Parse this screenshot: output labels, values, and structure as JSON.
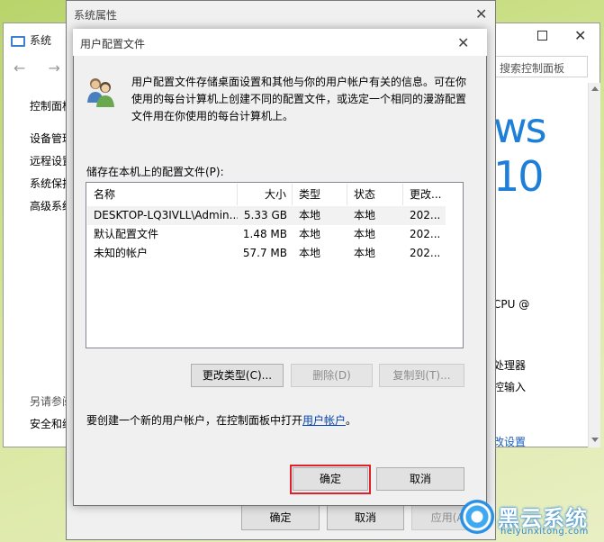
{
  "system_window": {
    "title": "系统",
    "nav": "← →",
    "left_links": [
      "控制面板主页",
      "设备管理器",
      "远程设置",
      "系统保护",
      "高级系统设置"
    ],
    "see_also_label": "另请参阅",
    "see_also_item": "安全和维护",
    "search_placeholder": "搜索控制面板",
    "windows_brand": "ws 10",
    "cpu_text": "CPU @",
    "processor_text": "处理器",
    "touch_text": "控输入",
    "change_settings_link": "改设置"
  },
  "system_properties": {
    "title": "系统属性",
    "close": "✕",
    "ok": "确定",
    "cancel": "取消",
    "apply": "应用(A)"
  },
  "profile_dialog": {
    "title": "用户配置文件",
    "close": "✕",
    "description": "用户配置文件存储桌面设置和其他与你的用户帐户有关的信息。可在你使用的每台计算机上创建不同的配置文件，或选定一个相同的漫游配置文件用在你使用的每台计算机上。",
    "stored_label": "储存在本机上的配置文件(P):",
    "columns": [
      "名称",
      "大小",
      "类型",
      "状态",
      "更改..."
    ],
    "rows": [
      {
        "name": "DESKTOP-LQ3IVLL\\Admin...",
        "size": "5.33 GB",
        "type": "本地",
        "status": "本地",
        "modified": "202..."
      },
      {
        "name": "默认配置文件",
        "size": "1.48 MB",
        "type": "本地",
        "status": "本地",
        "modified": "202..."
      },
      {
        "name": "未知的帐户",
        "size": "57.7 MB",
        "type": "本地",
        "status": "本地",
        "modified": "202..."
      }
    ],
    "change_type": "更改类型(C)...",
    "delete": "删除(D)",
    "copy_to": "复制到(T)...",
    "create_text": "要创建一个新的用户帐户，在控制面板中打开",
    "create_link": "用户帐户",
    "create_suffix": "。",
    "ok": "确定",
    "cancel": "取消"
  },
  "watermark": {
    "text": "黑云系统",
    "url": "heiyunxitong.com"
  },
  "colors": {
    "highlight_outline": "#e0202a",
    "link": "#0645ad",
    "win_blue": "#1e7fd8"
  }
}
